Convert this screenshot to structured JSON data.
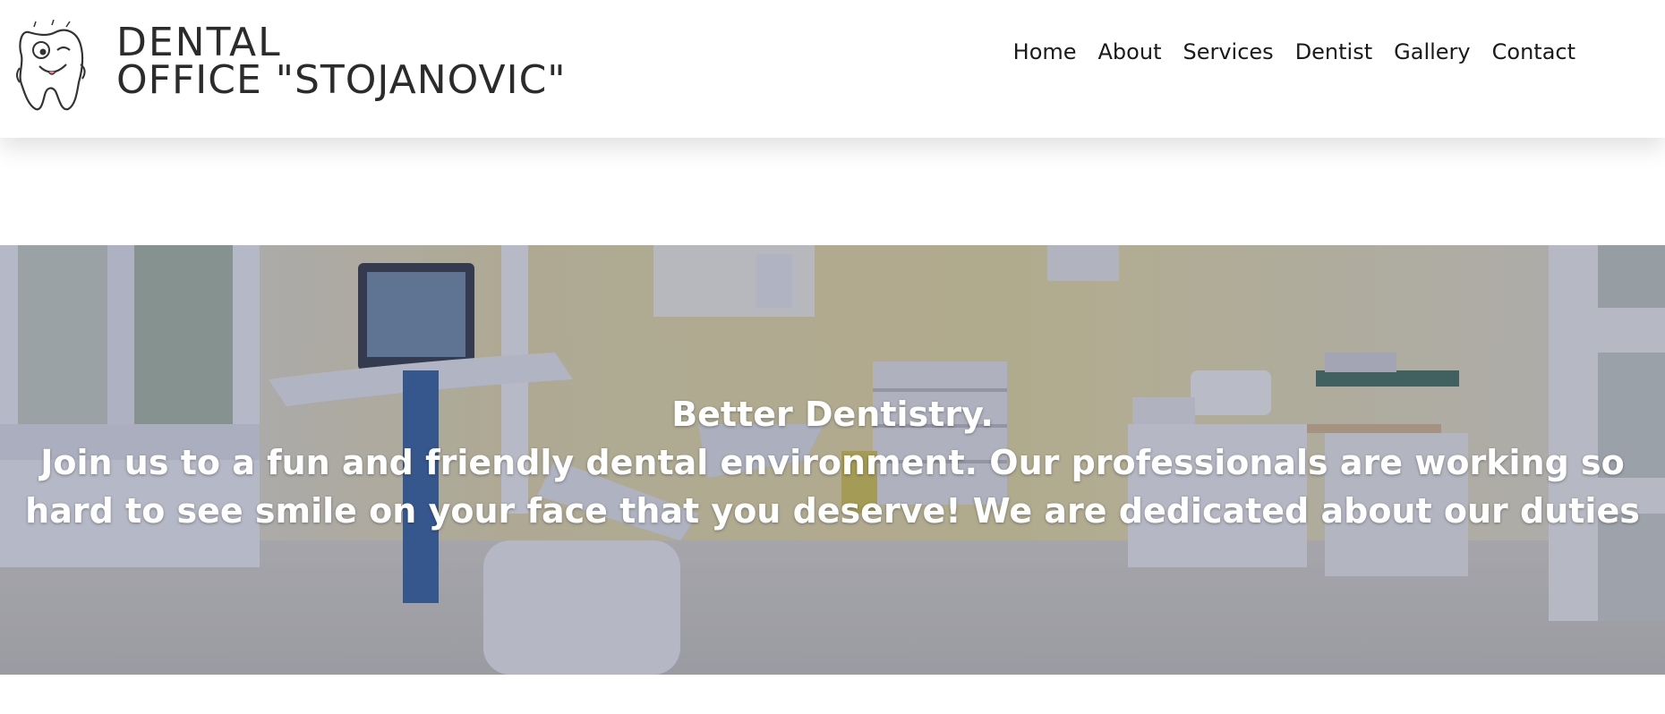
{
  "logo": {
    "line1": "DENTAL",
    "line2": "OFFICE \"STOJANOVIC\"",
    "mascot_icon": "tooth-mascot-icon"
  },
  "nav": {
    "items": [
      {
        "label": "Home"
      },
      {
        "label": "About"
      },
      {
        "label": "Services"
      },
      {
        "label": "Dentist"
      },
      {
        "label": "Gallery"
      },
      {
        "label": "Contact"
      }
    ]
  },
  "hero": {
    "title": "Better Dentistry.",
    "subtitle": "Join us to a fun and friendly dental environment. Our professionals are working so hard to see smile on your face that you deserve! We are dedicated about our duties"
  },
  "colors": {
    "text_dark": "#1a1a1a",
    "hero_overlay": "#464a6e",
    "room_wall": "#e9dba0"
  }
}
